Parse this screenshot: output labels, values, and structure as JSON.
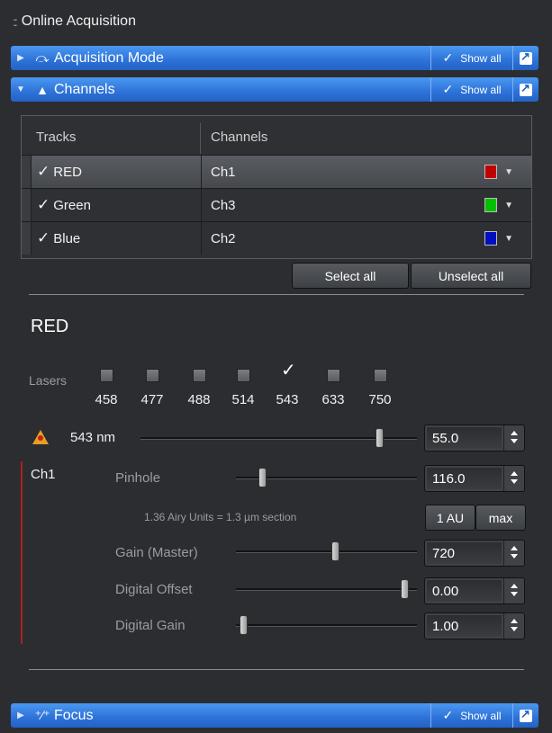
{
  "panel": {
    "title": "Online Acquisition"
  },
  "sections": {
    "acquisition_mode": {
      "title": "Acquisition Mode",
      "show_all": "Show all"
    },
    "channels": {
      "title": "Channels",
      "show_all": "Show all"
    },
    "focus": {
      "title": "Focus",
      "show_all": "Show all"
    }
  },
  "table": {
    "headers": {
      "tracks": "Tracks",
      "channels": "Channels"
    },
    "rows": [
      {
        "track": "RED",
        "channel": "Ch1",
        "color": "#c00000",
        "checked": true,
        "selected": true
      },
      {
        "track": "Green",
        "channel": "Ch3",
        "color": "#00c000",
        "checked": true,
        "selected": false
      },
      {
        "track": "Blue",
        "channel": "Ch2",
        "color": "#0010c0",
        "checked": true,
        "selected": false
      }
    ]
  },
  "buttons": {
    "select_all": "Select all",
    "unselect_all": "Unselect all",
    "one_au": "1 AU",
    "max": "max"
  },
  "track_detail": {
    "title": "RED",
    "lasers_label": "Lasers",
    "lasers": [
      {
        "wavelength": "458",
        "checked": false
      },
      {
        "wavelength": "477",
        "checked": false
      },
      {
        "wavelength": "488",
        "checked": false
      },
      {
        "wavelength": "514",
        "checked": false
      },
      {
        "wavelength": "543",
        "checked": true
      },
      {
        "wavelength": "633",
        "checked": false
      },
      {
        "wavelength": "750",
        "checked": false
      }
    ],
    "laser_power": {
      "label": "543 nm",
      "value": "55.0",
      "fraction": 0.92
    },
    "channel_label": "Ch1",
    "pinhole": {
      "label": "Pinhole",
      "value": "116.0",
      "fraction": 0.13
    },
    "airy_info": "1.36 Airy Units   =   1.3 µm section",
    "gain": {
      "label": "Gain (Master)",
      "value": "720",
      "fraction": 0.52
    },
    "digital_offset": {
      "label": "Digital Offset",
      "value": "0.00",
      "fraction": 0.96
    },
    "digital_gain": {
      "label": "Digital Gain",
      "value": "1.00",
      "fraction": 0.0
    }
  }
}
